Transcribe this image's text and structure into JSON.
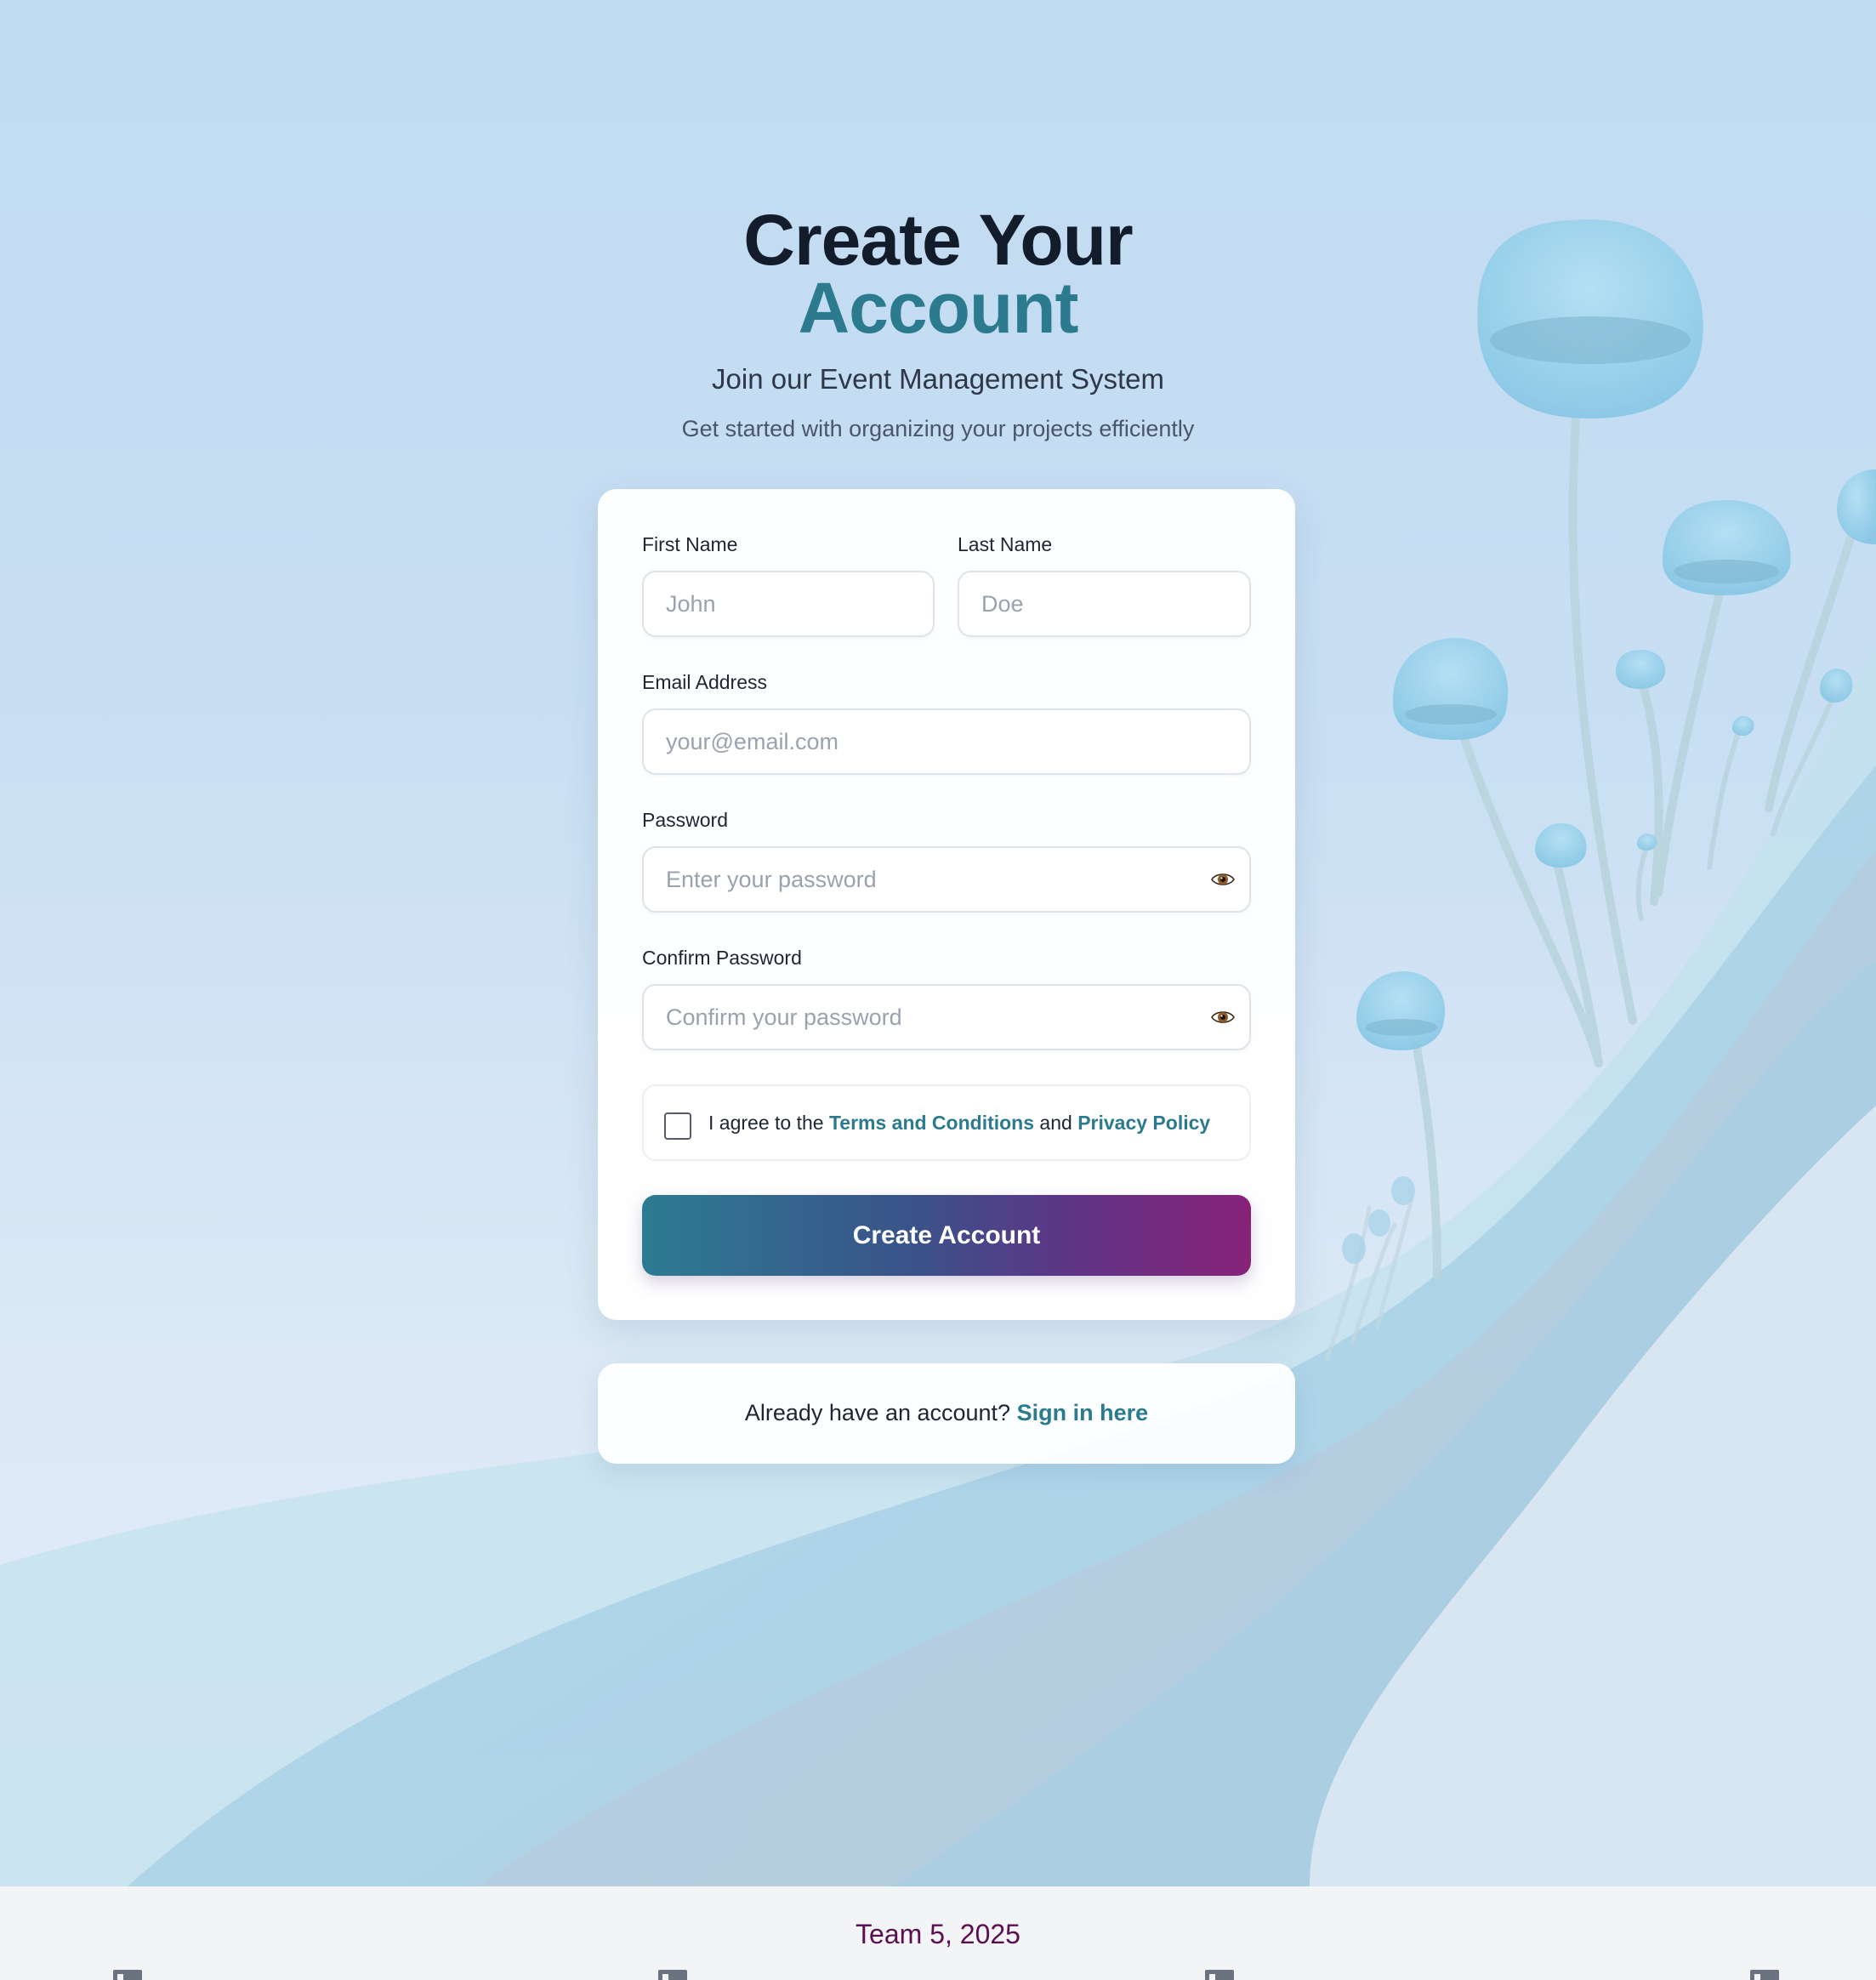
{
  "header": {
    "title_line1": "Create Your",
    "title_line2": "Account",
    "subtitle": "Join our Event Management System",
    "tagline": "Get started with organizing your projects efficiently"
  },
  "form": {
    "first_name": {
      "label": "First Name",
      "placeholder": "John",
      "value": ""
    },
    "last_name": {
      "label": "Last Name",
      "placeholder": "Doe",
      "value": ""
    },
    "email": {
      "label": "Email Address",
      "placeholder": "your@email.com",
      "value": ""
    },
    "password": {
      "label": "Password",
      "placeholder": "Enter your password",
      "value": "",
      "toggle_icon": "eye-icon"
    },
    "confirm_password": {
      "label": "Confirm Password",
      "placeholder": "Confirm your password",
      "value": "",
      "toggle_icon": "eye-icon"
    },
    "terms": {
      "checked": false,
      "prefix": "I agree to the",
      "terms_link": "Terms and Conditions",
      "conjunction": "and",
      "privacy_link": "Privacy Policy"
    },
    "submit_label": "Create Account"
  },
  "signin": {
    "prompt": "Already have an account?",
    "link_label": "Sign in here"
  },
  "footer": {
    "text": "Team 5, 2025",
    "icons": [
      "image-icon",
      "image-icon",
      "image-icon",
      "image-icon"
    ]
  },
  "colors": {
    "accent": "#2b7a8e",
    "title": "#131c2b",
    "button_gradient_start": "#2d7b93",
    "button_gradient_end": "#882279",
    "footer_text": "#5a1050"
  }
}
